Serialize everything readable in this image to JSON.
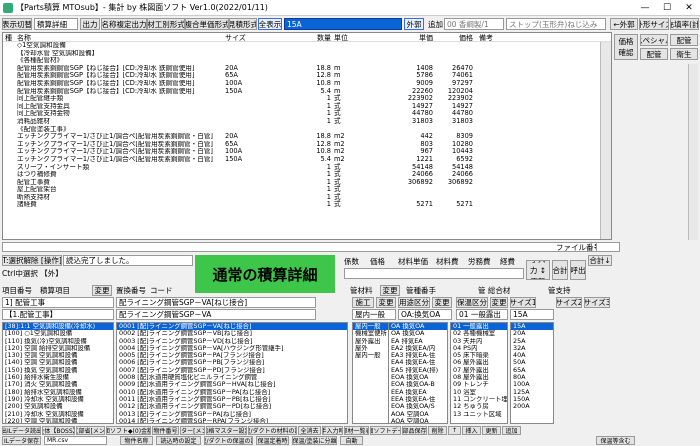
{
  "title": "【Parts積算 MTOsub】- 集計 by 株図面ソフト  Ver1.0(2022/01/11)",
  "toolbar": {
    "display_btn": "表示切替",
    "mode": "積算詳細",
    "output_btn": "出力",
    "opts": [
      "名称複定出力",
      "材工別形式",
      "複合単価形式",
      "見積形式"
    ],
    "full_display": "全表示",
    "field_value": "15A",
    "outer_btn": "外郭",
    "add_btn": "追加",
    "next_field": "00 香綱製/1",
    "stop_field": "ストップ(玉形弁)ねじ込み",
    "outside_btn": "←外郭",
    "size_btn": "外形サイズ",
    "fill_btn": "充填率(計)"
  },
  "grid": {
    "headers": [
      "種",
      "名称",
      "サイズ",
      "数量",
      "単位",
      "単価",
      "価格",
      "備考"
    ],
    "rows": [
      [
        "",
        "◇1空気調和設備",
        "",
        "",
        "",
        "",
        "",
        ""
      ],
      [
        "",
        "【冷却水管 空気調和設備】",
        "",
        "",
        "",
        "",
        "",
        ""
      ],
      [
        "",
        "《各種配管材》",
        "",
        "",
        "",
        "",
        "",
        ""
      ],
      [
        "",
        "配管用炭素鋼鋼管SGP【ねじ接合】[CD:冷却水 鉄鋼管使用]",
        "20A",
        "18.8",
        "m",
        "1408",
        "26470",
        ""
      ],
      [
        "",
        "配管用炭素鋼鋼管SGP【ねじ接合】[CD:冷却水 鉄鋼管使用]",
        "65A",
        "12.8",
        "m",
        "5786",
        "74061",
        ""
      ],
      [
        "",
        "配管用炭素鋼鋼管SGP【ねじ接合】[CD:冷却水 鉄鋼管使用]",
        "100A",
        "10.8",
        "m",
        "9009",
        "97297",
        ""
      ],
      [
        "",
        "配管用炭素鋼鋼管SGP【ねじ接合】[CD:冷却水 鉄鋼管使用]",
        "150A",
        "5.4",
        "m",
        "22260",
        "120204",
        ""
      ],
      [
        "",
        "同上配管継手類",
        "",
        "1",
        "式",
        "223902",
        "223902",
        ""
      ],
      [
        "",
        "同上配管支持金具",
        "",
        "1",
        "式",
        "14927",
        "14927",
        ""
      ],
      [
        "",
        "同上配管支持金物",
        "",
        "1",
        "式",
        "44780",
        "44780",
        ""
      ],
      [
        "",
        "消耗品雑材",
        "",
        "1",
        "式",
        "31803",
        "31803",
        ""
      ],
      [
        "",
        "《配管塗装工事》",
        "",
        "",
        "",
        "",
        "",
        ""
      ],
      [
        "",
        "エッチングプライマー1/さび止1/調合ペ[配管用炭素鋼鋼管・白管]",
        "20A",
        "18.8",
        "m2",
        "442",
        "8309",
        ""
      ],
      [
        "",
        "エッチングプライマー1/さび止1/調合ペ[配管用炭素鋼鋼管・白管]",
        "65A",
        "12.8",
        "m2",
        "803",
        "10280",
        ""
      ],
      [
        "",
        "エッチングプライマー1/さび止1/調合ペ[配管用炭素鋼鋼管・白管]",
        "100A",
        "10.8",
        "m2",
        "967",
        "10443",
        ""
      ],
      [
        "",
        "エッチングプライマー1/さび止1/調合ペ[配管用炭素鋼鋼管・白管]",
        "150A",
        "5.4",
        "m2",
        "1221",
        "6592",
        ""
      ],
      [
        "",
        "スリーブ・インサート類",
        "",
        "1",
        "式",
        "54148",
        "54148",
        ""
      ],
      [
        "",
        "はつり補修費",
        "",
        "1",
        "式",
        "24066",
        "24066",
        ""
      ],
      [
        "",
        "配管工事費",
        "",
        "1",
        "式",
        "306892",
        "306892",
        ""
      ],
      [
        "",
        "屋上配管架台",
        "",
        "1",
        "式",
        "",
        "",
        ""
      ],
      [
        "",
        "断熱支持材",
        "",
        "1",
        "式",
        "",
        "",
        ""
      ],
      [
        "",
        "諸経費",
        "",
        "1",
        "式",
        "5271",
        "5271",
        ""
      ]
    ]
  },
  "right_panel": {
    "btns": [
      "価格確認",
      "ダクト",
      "スペシャル",
      "配管",
      "衛生"
    ]
  },
  "file_label": "ファイル番号",
  "mid": {
    "t_btn": "T:選択解除 [操作]",
    "status": "読込完了しました。",
    "ctrl_label": "Ctrl中選択 【外】",
    "green": "通常の積算詳細",
    "col_labels": [
      "係数",
      "価格",
      "材料単価",
      "材料費",
      "労務費",
      "経費"
    ],
    "side_btns": [
      "手入力 ↕更新",
      "合計",
      "呼出"
    ],
    "total_btn": "合計↓"
  },
  "row2": {
    "item_no": "項目番号",
    "calc_item": "積算項目",
    "change1": "変更",
    "repl_no": "置換番号",
    "code": "コード",
    "name_value": "1] 配管工事",
    "type_value": "【1.配管工事】",
    "name2": "配ライニング鋼管SGP－VA[ねじ接合]",
    "name3": "配ライニング鋼管SGP－VA",
    "mat_label": "管材料",
    "change2": "変更",
    "grade": "管種番手",
    "pipe_name": "管 総合材",
    "tube_label": "管支持"
  },
  "row3": {
    "labels": [
      "施工",
      "変更",
      "用途区分",
      "変更",
      "保温区分",
      "変更",
      "サイズ1",
      "サイズ2",
      "サイズ3"
    ],
    "v1": "屋内一般",
    "v2": "OA:換気OA",
    "v3": "01 一般露出",
    "v4": "15A"
  },
  "list1": [
    "[38]:1:1 空気調和設備(冷却水)",
    "[100] ○1空気調和設備",
    "[110] 換気(冷)空気調和設備",
    "[120] 空調 給排空気調和設備",
    "[130] 空調 空気調和設備",
    "[140] 空調 空気調和設備",
    "[150] 換気 空気調和設備",
    "[160] 給排水衛生設備",
    "[170] 消火 空気調和設備",
    "[180] 給排水空気調和設備",
    "[190] 冷却水 空気調和設備",
    "[200] 空気調和設備",
    "[210] 冷却水 空気調和設備",
    "[220] 空調 空気調和設備"
  ],
  "list2": [
    "0001 [配]ライニング鋼管SGP－VA[ねじ接合]",
    "0002 [配]ライニング鋼管SGP－VB[ねじ接合]",
    "0003 [配]ライニング鋼管SGP－VD[ねじ接合]",
    "0004 [配]ライニング鋼管SGP－VA[ハウジング形管継手]",
    "0005 [配]ライニング鋼管SGP－PA[フランジ接合]",
    "0006 [配]ライニング鋼管SGP－PB[フランジ接合]",
    "0007 [配]ライニング鋼管SGP－PD[フランジ接合]",
    "0008 [配]水道用硬質塩化ビニルライニング鋼管",
    "0009 [配]水道用ライニング鋼管SGP－HVA[ねじ接合]",
    "0010 [配]水道用ライニング鋼管SGP－PA[ねじ接合]",
    "0011 [配]水道用ライニング鋼管SGP－PB[ねじ接合]",
    "0012 [配]水道用ライニング鋼管SGP－PD[ねじ接合]",
    "0013 [配]ライニング鋼管SGP－PA[ねじ接合]",
    "0014 [配]ライニング鋼管SGP－RPA[フランジ接合]"
  ],
  "list3": [
    "屋内一般",
    "機械室便所",
    "屋外露出",
    "屋外",
    "屋内一般"
  ],
  "list4": [
    "OA 換気OA",
    "OA 換気OA",
    "EA 排気EA",
    "EA2 換気EA/内",
    "EA3 排気EA-住",
    "EA4 換気EA-住",
    "EA5 排気EA(排)",
    "EOA 換気OA",
    "EOA 換気OA-B",
    "EEA 換気EA",
    "EEA 換気EA-住",
    "EOA 換気OA/S",
    "AOA 空調OA",
    "AOA 空調OA"
  ],
  "list5": [
    "01 一般露出",
    "02 各種機械室",
    "03 天井内",
    "04 PS内",
    "05 床下暗渠",
    "06 屋外露出",
    "07 屋外露出",
    "08 屋外露出",
    "09 トレンチ",
    "10 浴室",
    "11 コンクリート埋設",
    "12 ちゅう房",
    "13 ユニット区域"
  ],
  "list6": [
    "15A",
    "20A",
    "25A",
    "32A",
    "40A",
    "50A",
    "65A",
    "80A",
    "100A",
    "125A",
    "150A",
    "200A"
  ],
  "bottom": {
    "r1": [
      "出ILデータ読出",
      "全体【BOSS】",
      "◆文部省[メンテ]",
      "図面ソフト◆(0)金額計",
      "物件番号",
      "マスター[メンテ]",
      "価格マスター設定",
      "配管/ダクトの材料の設定",
      "全消去",
      "手入力時",
      "部材一覧表",
      "図面ソフトデータ",
      "部品保存",
      "削除",
      "↑",
      "挿入",
      "更新",
      "追加"
    ],
    "r2": [
      "ILデータ保存",
      "MR.csv",
      "物件名称",
      "読込時の設定",
      "配管/ダクトの保温の設定",
      "保温定着時",
      "保温/塗装に分離",
      "自動",
      "保温等含む"
    ]
  }
}
